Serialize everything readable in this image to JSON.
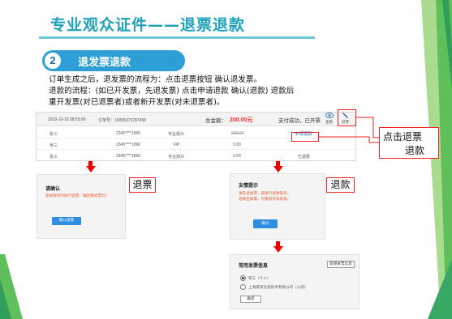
{
  "slide": {
    "title": "专业观众证件——退票退款",
    "step_number": "2",
    "step_title": "退发票退款",
    "desc_lines": [
      "订单生成之后，退发票的流程为：点击退票按钮  确认退发票。",
      "退款的流程：(如已开发票，先退发票)   点击申请退款   确认(退款)   退款后",
      "重开发票(对已退票者)或者新开发票(对未退票者)。"
    ]
  },
  "order": {
    "date": "2019-10-18 08:55:00",
    "order_no": "订单号：10098373787458",
    "total_label": "总金额：",
    "total_amount": "200.00元",
    "status": "支付成功，已开票",
    "view_label": "查看",
    "refund_label": "退票",
    "rows": [
      {
        "name": "张三",
        "phone": "2345****1890",
        "type": "专业观众",
        "price": "200.00",
        "action": "申请退款"
      },
      {
        "name": "张三",
        "phone": "2345****1890",
        "type": "VIP",
        "price": "0.00",
        "action": ""
      },
      {
        "name": "张三",
        "phone": "2345****1890",
        "type": "专业观众",
        "price": "0.00",
        "action": "已退款"
      }
    ]
  },
  "callout": {
    "line1": "点击退票",
    "line2": "退款"
  },
  "dialog_ticket": {
    "title": "请确认",
    "text": "系统将同时执行退票，确定要退票吗？",
    "button": "确认退票",
    "label": "退票"
  },
  "dialog_refund": {
    "title": "友情提示",
    "text_line1": "请先退发票，再进行退款操作。",
    "text_line2": "退款后如需，可重新开具发票。",
    "button": "确认",
    "label": "退款"
  },
  "invoice_panel": {
    "title": "常用发票信息",
    "new_button": "新增发票信息",
    "options": [
      "张三（个人）",
      "上海某某信息技术有限公司（公司）"
    ],
    "confirm_button": "确定"
  },
  "colors": {
    "accent": "#1fa1ba",
    "badge": "#2e9fd6",
    "alert": "#e22222",
    "primary_button": "#2e8fe0"
  }
}
